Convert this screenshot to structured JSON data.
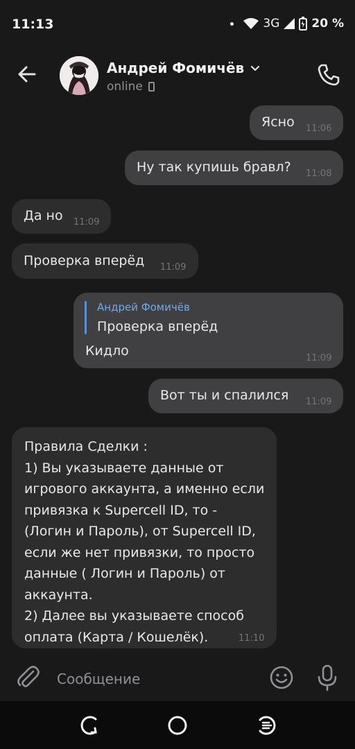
{
  "status": {
    "time": "11:13",
    "network": "3G",
    "battery": "20 %"
  },
  "header": {
    "name": "Андрей Фомичёв",
    "status": "online"
  },
  "messages": [
    {
      "text": "Ясно",
      "time": "11:06"
    },
    {
      "text": "Ну так купишь бравл?",
      "time": "11:08"
    },
    {
      "text": "Да но",
      "time": "11:09"
    },
    {
      "text": "Проверка вперёд",
      "time": "11:09"
    },
    {
      "reply_author": "Андрей Фомичёв",
      "reply_text": "Проверка вперёд",
      "text": "Кидло",
      "time": "11:09"
    },
    {
      "text": "Вот ты и спалился",
      "time": "11:09"
    },
    {
      "text": "Правила Сделки :\n1) Вы указываете данные от игрового аккаунта, а именно если привязка к Supercell ID, то - (Логин и Пароль), от Supercell ID, если же нет привязки, то просто данные ( Логин и Пароль) от аккаунта.\n2) Далее вы указываете способ оплата (Карта / Кошелёк).",
      "time": "11:10"
    }
  ],
  "composer": {
    "placeholder": "Сообщение"
  },
  "icons": {
    "back": "back-arrow-icon",
    "call": "phone-icon",
    "attach": "paperclip-icon",
    "emoji": "emoji-icon",
    "mic": "microphone-icon"
  },
  "colors": {
    "background": "#19191a",
    "bubble_in": "#2d2d2e",
    "bubble_out": "#404042",
    "reply_accent": "#71aaeb"
  }
}
